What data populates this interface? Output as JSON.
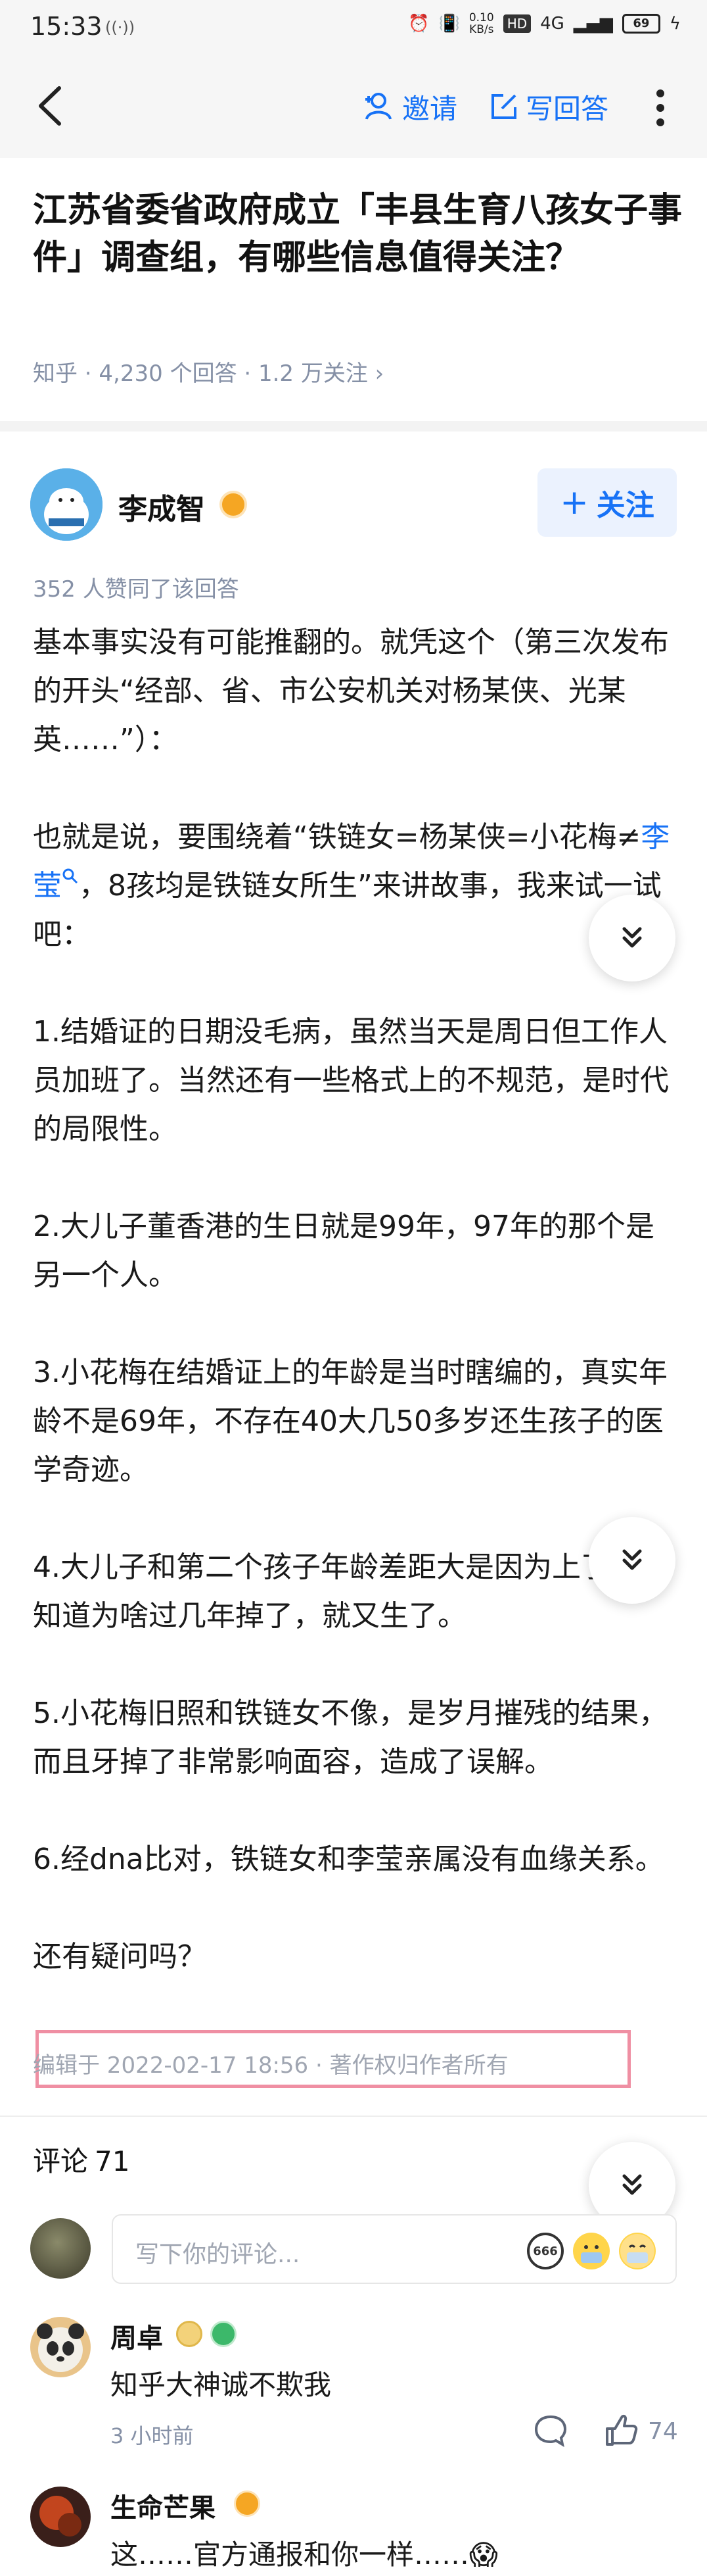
{
  "status_bar": {
    "time": "15:33",
    "speed": "0.10",
    "speed_unit": "KB/s",
    "hd": "HD",
    "network": "4G",
    "battery": "69"
  },
  "toolbar": {
    "invite_label": "邀请",
    "write_label": "写回答"
  },
  "question": {
    "title": "江苏省委省政府成立「丰县生育八孩女子事件」调查组，有哪些信息值得关注？",
    "meta": "知乎 · 4,230 个回答 · 1.2 万关注 ›"
  },
  "author": {
    "name": "李成智",
    "follow_label": "关注"
  },
  "answer": {
    "votes": "352 人赞同了该回答",
    "p1": "基本事实没有可能推翻的。就凭这个（第三次发布的开头“经部、省、市公安机关对杨某侠、光某英……”）：",
    "p2_before": "也就是说，要围绕着“铁链女=杨某侠=小花梅≠",
    "p2_link": "李莹",
    "p2_after": "，8孩均是铁链女所生”来讲故事，我来试一试吧：",
    "p3": "1.结婚证的日期没毛病，虽然当天是周日但工作人员加班了。当然还有一些格式上的不规范，是时代的局限性。",
    "p4": "2.大儿子董香港的生日就是99年，97年的那个是另一个人。",
    "p5": "3.小花梅在结婚证上的年龄是当时瞎编的，真实年龄不是69年，不存在40大几50多岁还生孩子的医学奇迹。",
    "p6": "4.大儿子和第二个孩子年龄差距大是因为上了环不知道为啥过几年掉了，就又生了。",
    "p7": "5.小花梅旧照和铁链女不像，是岁月摧残的结果，而且牙掉了非常影响面容，造成了误解。",
    "p8": "6.经dna比对，铁链女和李莹亲属没有血缘关系。",
    "p9": "还有疑问吗？",
    "edit_meta": "编辑于 2022-02-17 18:56 · 著作权归作者所有"
  },
  "comments": {
    "title": "评论",
    "count": "71",
    "placeholder": "写下你的评论...",
    "emoji_666": "666",
    "items": [
      {
        "name": "周卓",
        "text": "知乎大神诚不欺我",
        "time": "3 小时前",
        "likes": "74"
      },
      {
        "name": "生命芒果",
        "text": "这……官方通报和你一样……😱"
      }
    ]
  },
  "colors": {
    "brand": "#1772f6",
    "meta": "#8590a6",
    "highlight_box": "#ef8fa3"
  }
}
